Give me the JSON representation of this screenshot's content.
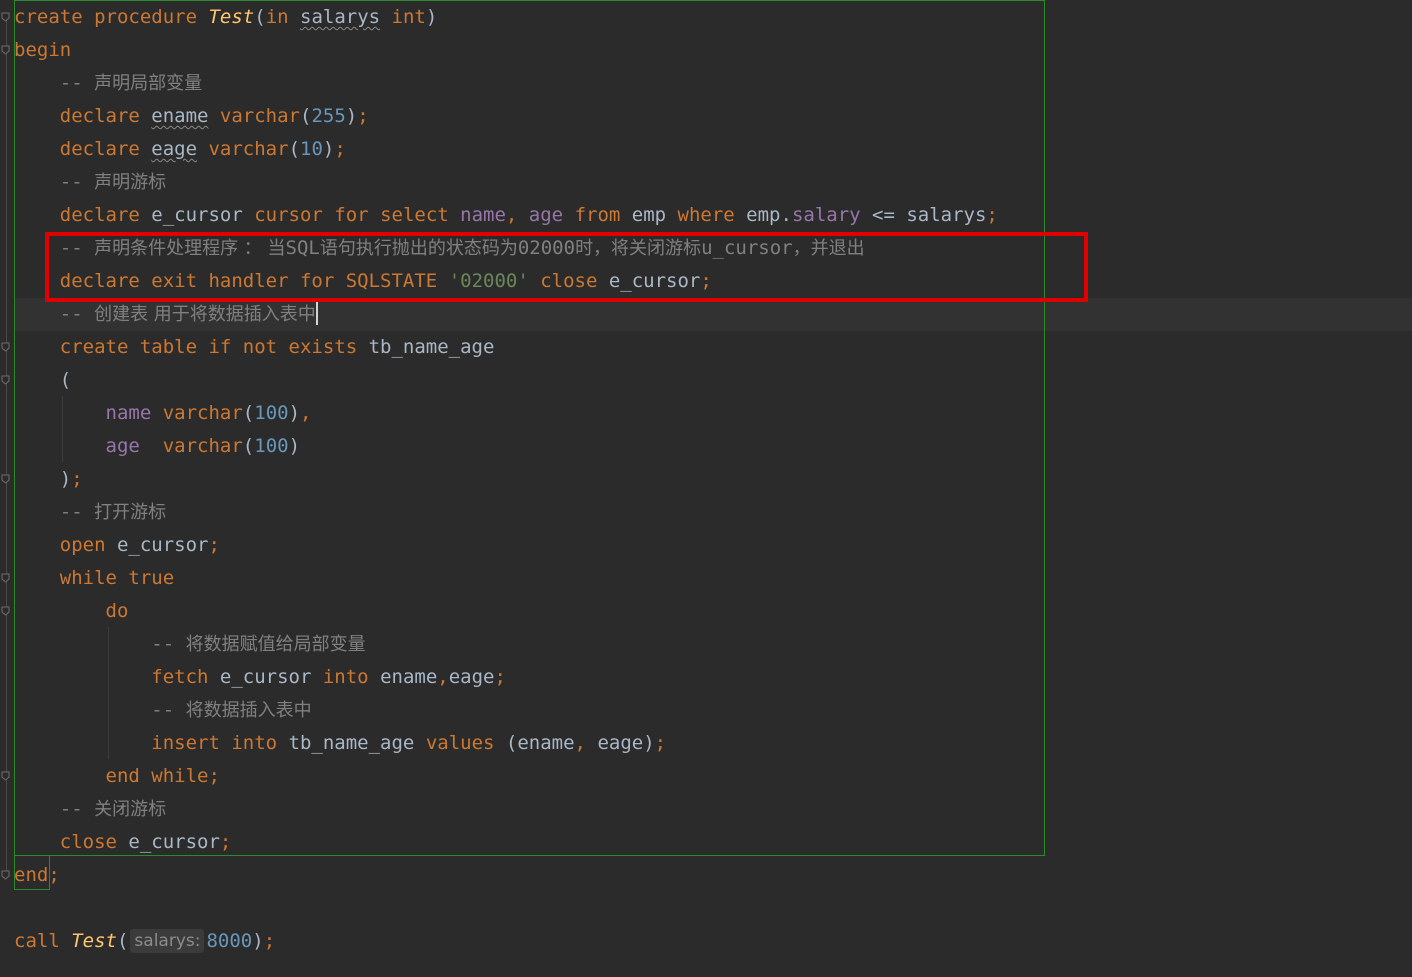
{
  "editor": {
    "highlight_color": "#e00000",
    "block_border_color": "#2c8a2c",
    "background": "#2b2b2b",
    "caret_line": 9,
    "lines": [
      [
        {
          "t": "kw",
          "v": "create procedure "
        },
        {
          "t": "fn",
          "v": "Test"
        },
        {
          "t": "id",
          "v": "("
        },
        {
          "t": "kw",
          "v": "in "
        },
        {
          "t": "id wavy",
          "v": "salarys"
        },
        {
          "t": "kw",
          "v": " int"
        },
        {
          "t": "id",
          "v": ")"
        }
      ],
      [
        {
          "t": "kw",
          "v": "begin"
        }
      ],
      [
        {
          "t": "cmt-m",
          "v": "    -- "
        },
        {
          "t": "cmt",
          "v": "声明局部变量"
        }
      ],
      [
        {
          "t": "kw",
          "v": "    declare "
        },
        {
          "t": "id wavy",
          "v": "ename"
        },
        {
          "t": "kw",
          "v": " varchar"
        },
        {
          "t": "id",
          "v": "("
        },
        {
          "t": "num",
          "v": "255"
        },
        {
          "t": "id",
          "v": ")"
        },
        {
          "t": "kw",
          "v": ";"
        }
      ],
      [
        {
          "t": "kw",
          "v": "    declare "
        },
        {
          "t": "id wavy",
          "v": "eage"
        },
        {
          "t": "kw",
          "v": " varchar"
        },
        {
          "t": "id",
          "v": "("
        },
        {
          "t": "num",
          "v": "10"
        },
        {
          "t": "id",
          "v": ")"
        },
        {
          "t": "kw",
          "v": ";"
        }
      ],
      [
        {
          "t": "cmt-m",
          "v": "    -- "
        },
        {
          "t": "cmt",
          "v": "声明游标"
        }
      ],
      [
        {
          "t": "kw",
          "v": "    declare "
        },
        {
          "t": "id",
          "v": "e_cursor "
        },
        {
          "t": "kw",
          "v": "cursor for select "
        },
        {
          "t": "col",
          "v": "name"
        },
        {
          "t": "kw",
          "v": ", "
        },
        {
          "t": "col",
          "v": "age"
        },
        {
          "t": "kw",
          "v": " from "
        },
        {
          "t": "id",
          "v": "emp "
        },
        {
          "t": "kw",
          "v": "where "
        },
        {
          "t": "id",
          "v": "emp."
        },
        {
          "t": "col",
          "v": "salary"
        },
        {
          "t": "id",
          "v": " <= salarys"
        },
        {
          "t": "kw",
          "v": ";"
        }
      ],
      [
        {
          "t": "cmt-m",
          "v": "    -- "
        },
        {
          "t": "cmt",
          "v": "声明条件处理程序 ： 当"
        },
        {
          "t": "cmt-m",
          "v": "SQL"
        },
        {
          "t": "cmt",
          "v": "语句执行抛出的状态码为"
        },
        {
          "t": "cmt-m",
          "v": "02000"
        },
        {
          "t": "cmt",
          "v": "时，将关闭游标"
        },
        {
          "t": "cmt-m",
          "v": "u_cursor"
        },
        {
          "t": "cmt",
          "v": "，并退出"
        }
      ],
      [
        {
          "t": "kw",
          "v": "    declare exit handler for SQLSTATE "
        },
        {
          "t": "str",
          "v": "'02000'"
        },
        {
          "t": "kw",
          "v": " close "
        },
        {
          "t": "id",
          "v": "e_cursor"
        },
        {
          "t": "kw",
          "v": ";"
        }
      ],
      [
        {
          "t": "cmt-m",
          "v": "    -- "
        },
        {
          "t": "cmt",
          "v": "创建表 用于将数据插入表中"
        }
      ],
      [
        {
          "t": "kw",
          "v": "    create table if not exists "
        },
        {
          "t": "id",
          "v": "tb_name_age"
        }
      ],
      [
        {
          "t": "id",
          "v": "    ("
        }
      ],
      [
        {
          "t": "col",
          "v": "        name"
        },
        {
          "t": "kw",
          "v": " varchar"
        },
        {
          "t": "id",
          "v": "("
        },
        {
          "t": "num",
          "v": "100"
        },
        {
          "t": "id",
          "v": ")"
        },
        {
          "t": "kw",
          "v": ","
        }
      ],
      [
        {
          "t": "col",
          "v": "        age"
        },
        {
          "t": "kw",
          "v": "  varchar"
        },
        {
          "t": "id",
          "v": "("
        },
        {
          "t": "num",
          "v": "100"
        },
        {
          "t": "id",
          "v": ")"
        }
      ],
      [
        {
          "t": "id",
          "v": "    )"
        },
        {
          "t": "kw",
          "v": ";"
        }
      ],
      [
        {
          "t": "cmt-m",
          "v": "    -- "
        },
        {
          "t": "cmt",
          "v": "打开游标"
        }
      ],
      [
        {
          "t": "kw",
          "v": "    open "
        },
        {
          "t": "id",
          "v": "e_cursor"
        },
        {
          "t": "kw",
          "v": ";"
        }
      ],
      [
        {
          "t": "kw",
          "v": "    while true"
        }
      ],
      [
        {
          "t": "kw",
          "v": "        do"
        }
      ],
      [
        {
          "t": "cmt-m",
          "v": "            -- "
        },
        {
          "t": "cmt",
          "v": "将数据赋值给局部变量"
        }
      ],
      [
        {
          "t": "kw",
          "v": "            fetch "
        },
        {
          "t": "id",
          "v": "e_cursor "
        },
        {
          "t": "kw",
          "v": "into "
        },
        {
          "t": "id",
          "v": "ename"
        },
        {
          "t": "kw",
          "v": ","
        },
        {
          "t": "id",
          "v": "eage"
        },
        {
          "t": "kw",
          "v": ";"
        }
      ],
      [
        {
          "t": "cmt-m",
          "v": "            -- "
        },
        {
          "t": "cmt",
          "v": "将数据插入表中"
        }
      ],
      [
        {
          "t": "kw",
          "v": "            insert into "
        },
        {
          "t": "id",
          "v": "tb_name_age "
        },
        {
          "t": "kw",
          "v": "values "
        },
        {
          "t": "id",
          "v": "(ename"
        },
        {
          "t": "kw",
          "v": ", "
        },
        {
          "t": "id",
          "v": "eage)"
        },
        {
          "t": "kw",
          "v": ";"
        }
      ],
      [
        {
          "t": "kw",
          "v": "        end while;"
        }
      ],
      [
        {
          "t": "cmt-m",
          "v": "    -- "
        },
        {
          "t": "cmt",
          "v": "关闭游标"
        }
      ],
      [
        {
          "t": "kw",
          "v": "    close "
        },
        {
          "t": "id",
          "v": "e_cursor"
        },
        {
          "t": "kw",
          "v": ";"
        }
      ],
      [
        {
          "t": "kw",
          "v": "end;"
        }
      ],
      [],
      [
        {
          "t": "kw",
          "v": "call "
        },
        {
          "t": "fn",
          "v": "Test"
        },
        {
          "t": "id",
          "v": "("
        },
        {
          "t": "hint",
          "v": "salarys:"
        },
        {
          "t": "num",
          "v": "8000"
        },
        {
          "t": "id",
          "v": ")"
        },
        {
          "t": "kw",
          "v": ";"
        }
      ]
    ]
  }
}
